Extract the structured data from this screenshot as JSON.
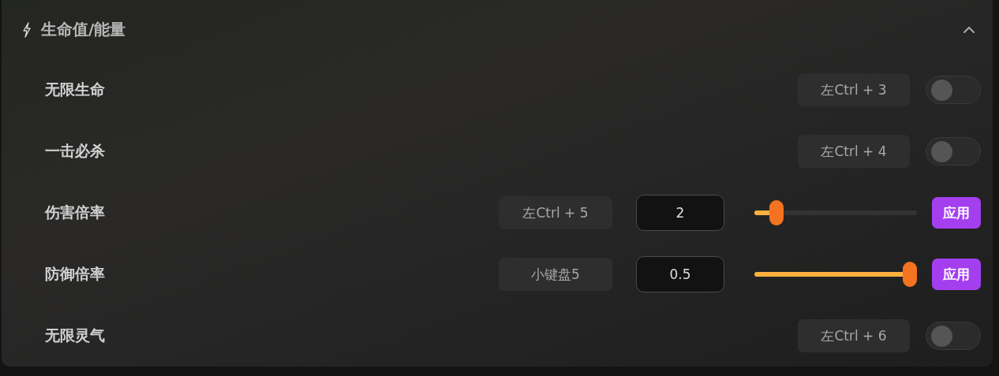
{
  "section": {
    "title": "生命值/能量",
    "expanded": true
  },
  "rows": [
    {
      "kind": "toggle",
      "label": "无限生命",
      "hotkey": "左Ctrl + 3",
      "on": false
    },
    {
      "kind": "toggle",
      "label": "一击必杀",
      "hotkey": "左Ctrl + 4",
      "on": false
    },
    {
      "kind": "slider",
      "label": "伤害倍率",
      "hotkey": "左Ctrl + 5",
      "value": "2",
      "level": 0.1,
      "button": "应用"
    },
    {
      "kind": "slider",
      "label": "防御倍率",
      "hotkey": "小键盘5",
      "value": "0.5",
      "level": 1,
      "button": "应用"
    },
    {
      "kind": "toggle",
      "label": "无限灵气",
      "hotkey": "左Ctrl + 6",
      "on": false
    }
  ]
}
